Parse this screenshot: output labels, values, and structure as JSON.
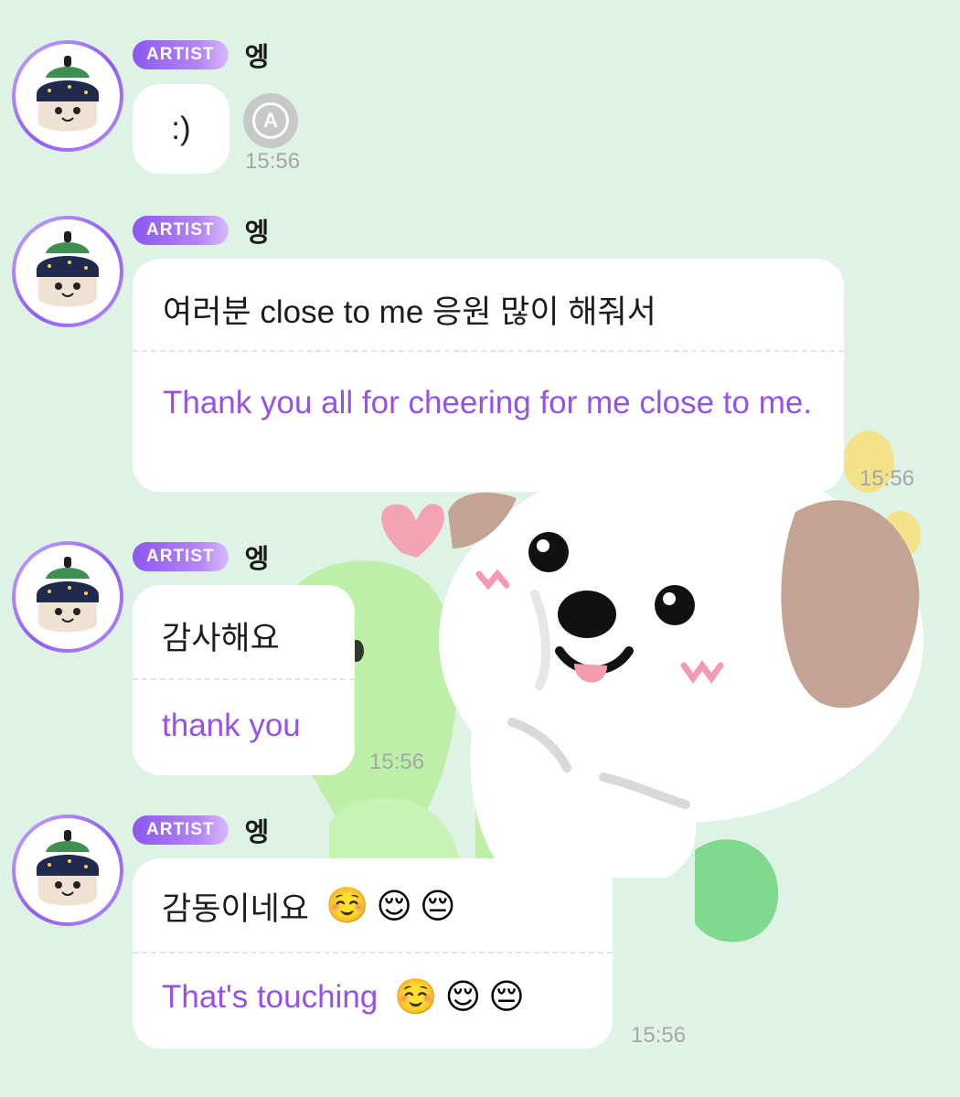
{
  "sender": {
    "badge": "ARTIST",
    "name": "엥"
  },
  "messages": [
    {
      "original": ":)",
      "translation": "",
      "time": "15:56"
    },
    {
      "original": "여러분 close to me 응원 많이 해줘서",
      "translation": "Thank you all for cheering for me close to me.",
      "time": "15:56"
    },
    {
      "original": "감사해요",
      "translation": "thank you",
      "time": "15:56"
    },
    {
      "original": "감동이네요",
      "translation": "That's touching",
      "time": "15:56"
    }
  ],
  "emojis": [
    "☺️",
    "😌",
    "😔"
  ],
  "translate_button": {
    "label": "A",
    "icon": "translate-icon"
  },
  "colors": {
    "background": "#dff2e6",
    "badge_start": "#8c57f0",
    "translation_text": "#9552e6",
    "timestamp": "#a3a8a5"
  }
}
